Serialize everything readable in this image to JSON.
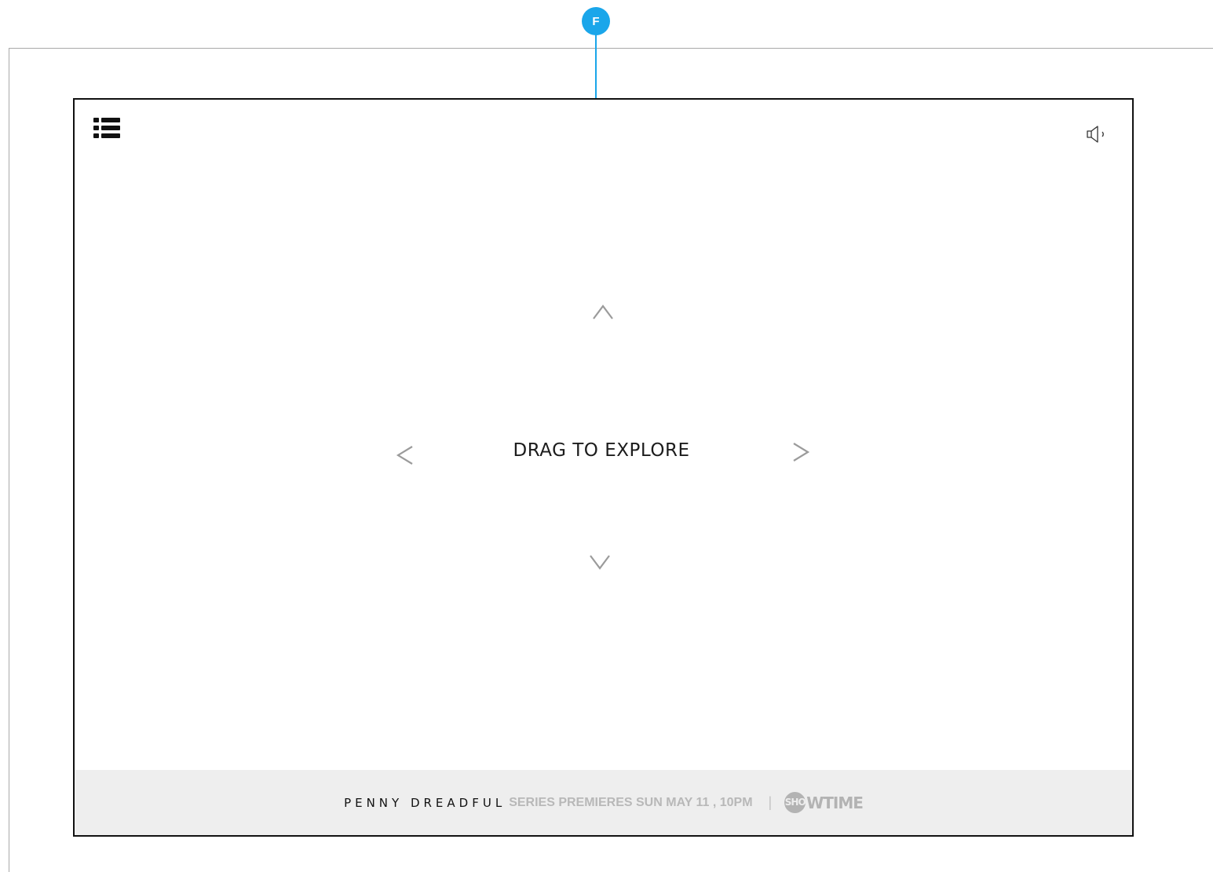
{
  "annotation": {
    "badge_label": "F",
    "color": "#1aa6ea"
  },
  "header": {
    "menu_icon": "list-menu-icon",
    "sound_icon": "speaker-icon"
  },
  "explore": {
    "label": "DRAG TO EXPLORE",
    "arrows": [
      "chevron-up-icon",
      "chevron-down-icon",
      "chevron-left-icon",
      "chevron-right-icon"
    ]
  },
  "promo": {
    "title": "PENNY DREADFUL",
    "text": "SERIES PREMIERES SUN MAY 11 , 10PM",
    "separator": "|",
    "brand_circle": "SHO",
    "brand_rest": "WTIME"
  },
  "colors": {
    "frame": "#111111",
    "promo_bg": "#eeeeee",
    "arrow": "#9b9b9b"
  }
}
